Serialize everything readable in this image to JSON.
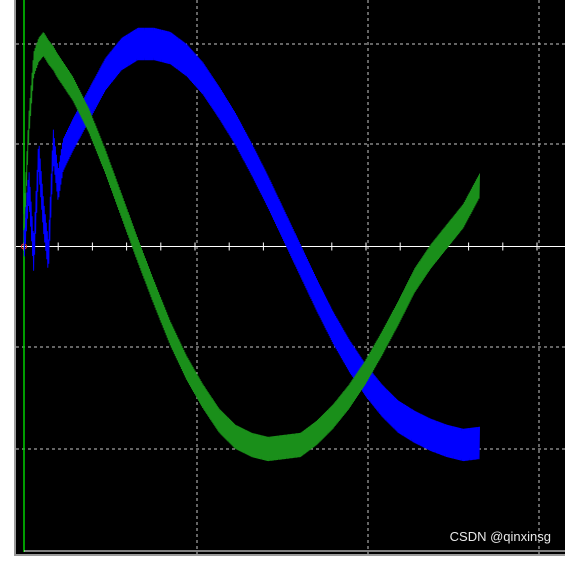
{
  "watermark": {
    "text": "CSDN @qinxinsg"
  },
  "colors": {
    "background": "#000000",
    "grid": "#c8c8c8",
    "axis": "#ffffff",
    "y_axis": "#00d000",
    "trace_blue": "#0000ff",
    "trace_green": "#1a8f1a",
    "frame": "#9a9a9a",
    "origin_marker": "#ff4040"
  },
  "chart_data": {
    "type": "line",
    "title": "",
    "xlabel": "",
    "ylabel": "",
    "grid": true,
    "grid_style": "dashed",
    "xlim": [
      0,
      1.5
    ],
    "ylim": [
      -1.1,
      1.1
    ],
    "series": [
      {
        "color": "#0000ff",
        "shape": "sine with startup transient and ripple",
        "x": [
          0.0,
          0.015,
          0.03,
          0.045,
          0.06,
          0.075,
          0.09,
          0.105,
          0.12,
          0.15,
          0.2,
          0.25,
          0.3,
          0.35,
          0.4,
          0.45,
          0.5,
          0.55,
          0.6,
          0.65,
          0.7,
          0.75,
          0.8,
          0.85,
          0.9,
          0.95,
          1.0,
          1.05,
          1.1,
          1.15,
          1.2,
          1.25,
          1.3,
          1.35,
          1.4
        ],
        "y": [
          0.0,
          0.3,
          -0.05,
          0.45,
          0.15,
          -0.05,
          0.5,
          0.3,
          0.45,
          0.55,
          0.7,
          0.85,
          0.95,
          1.0,
          1.0,
          0.98,
          0.92,
          0.83,
          0.71,
          0.58,
          0.43,
          0.27,
          0.1,
          -0.07,
          -0.24,
          -0.4,
          -0.54,
          -0.66,
          -0.76,
          -0.84,
          -0.89,
          -0.93,
          -0.96,
          -0.98,
          -0.97
        ],
        "ripple_amplitude": 0.08
      },
      {
        "color": "#1a8f1a",
        "shape": "sine with fast startup and ripple",
        "x": [
          0.0,
          0.015,
          0.03,
          0.045,
          0.06,
          0.075,
          0.09,
          0.1,
          0.15,
          0.2,
          0.25,
          0.3,
          0.35,
          0.4,
          0.45,
          0.5,
          0.55,
          0.6,
          0.65,
          0.7,
          0.75,
          0.8,
          0.85,
          0.9,
          0.95,
          1.0,
          1.05,
          1.1,
          1.15,
          1.2,
          1.25,
          1.3,
          1.35,
          1.4
        ],
        "y": [
          0.1,
          0.6,
          0.9,
          0.97,
          1.0,
          0.96,
          0.93,
          0.9,
          0.78,
          0.62,
          0.42,
          0.2,
          -0.02,
          -0.23,
          -0.43,
          -0.6,
          -0.74,
          -0.86,
          -0.94,
          -0.98,
          -1.0,
          -0.99,
          -0.98,
          -0.92,
          -0.84,
          -0.74,
          -0.62,
          -0.48,
          -0.33,
          -0.17,
          -0.05,
          0.05,
          0.15,
          0.3
        ],
        "ripple_amplitude": 0.06
      }
    ]
  }
}
